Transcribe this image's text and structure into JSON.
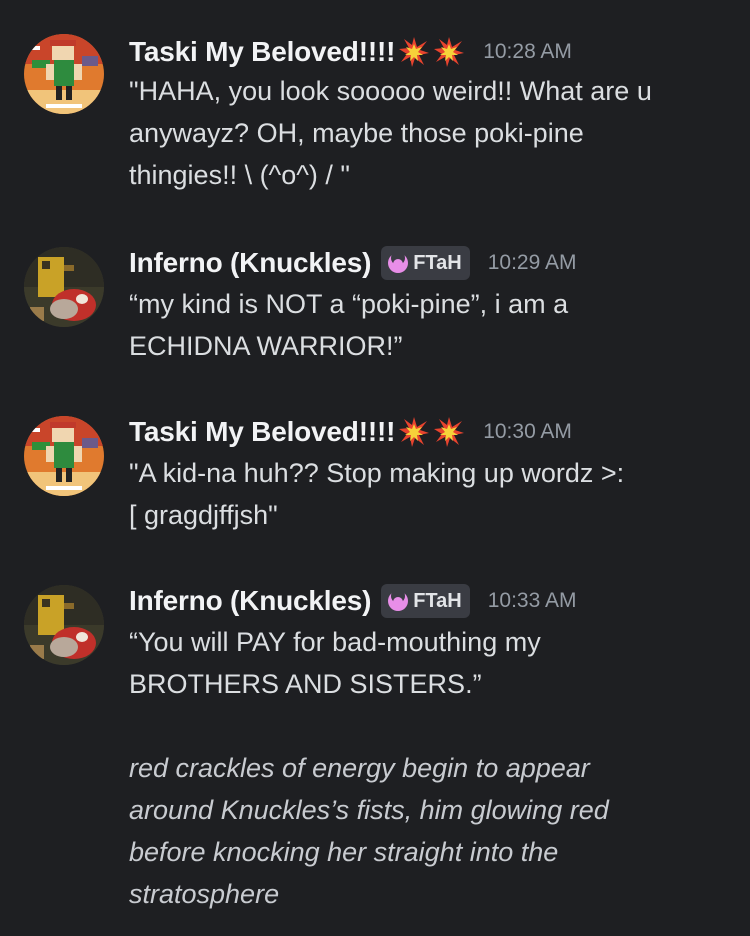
{
  "messages": [
    {
      "author": "Taski My Beloved!!!!",
      "author_emoji": [
        "collision-icon",
        "collision-icon"
      ],
      "timestamp": "10:28 AM",
      "lines": [
        "\"HAHA, you look sooooo weird!! What are u",
        "anywayz? OH, maybe those poki-pine",
        "thingies!!  \\ (^o^) / \""
      ]
    },
    {
      "author": "Inferno (Knuckles)",
      "tag": {
        "icon": "pink-moon-icon",
        "label": "FTaH"
      },
      "timestamp": "10:29 AM",
      "lines": [
        "“my kind is NOT a “poki-pine”, i am a",
        "ECHIDNA WARRIOR!”"
      ]
    },
    {
      "author": "Taski My Beloved!!!!",
      "author_emoji": [
        "collision-icon",
        "collision-icon"
      ],
      "timestamp": "10:30 AM",
      "lines": [
        "\"A kid-na huh?? Stop making up wordz >:",
        "[ gragdjffjsh\""
      ]
    },
    {
      "author": "Inferno (Knuckles)",
      "tag": {
        "icon": "pink-moon-icon",
        "label": "FTaH"
      },
      "timestamp": "10:33 AM",
      "lines": [
        "“You will PAY for bad-mouthing my",
        "BROTHERS AND SISTERS.”"
      ],
      "italic_lines": [
        "red crackles of energy begin to appear",
        "around Knuckles’s fists, him glowing red",
        "before knocking her straight into the",
        "stratosphere"
      ]
    }
  ],
  "colors": {
    "background": "#1e1f22",
    "username": "#f2f3f5",
    "text": "#dbdee1",
    "timestamp": "#949ba4",
    "tag_background": "#3a3c43",
    "tag_icon": "#e88ee8"
  }
}
